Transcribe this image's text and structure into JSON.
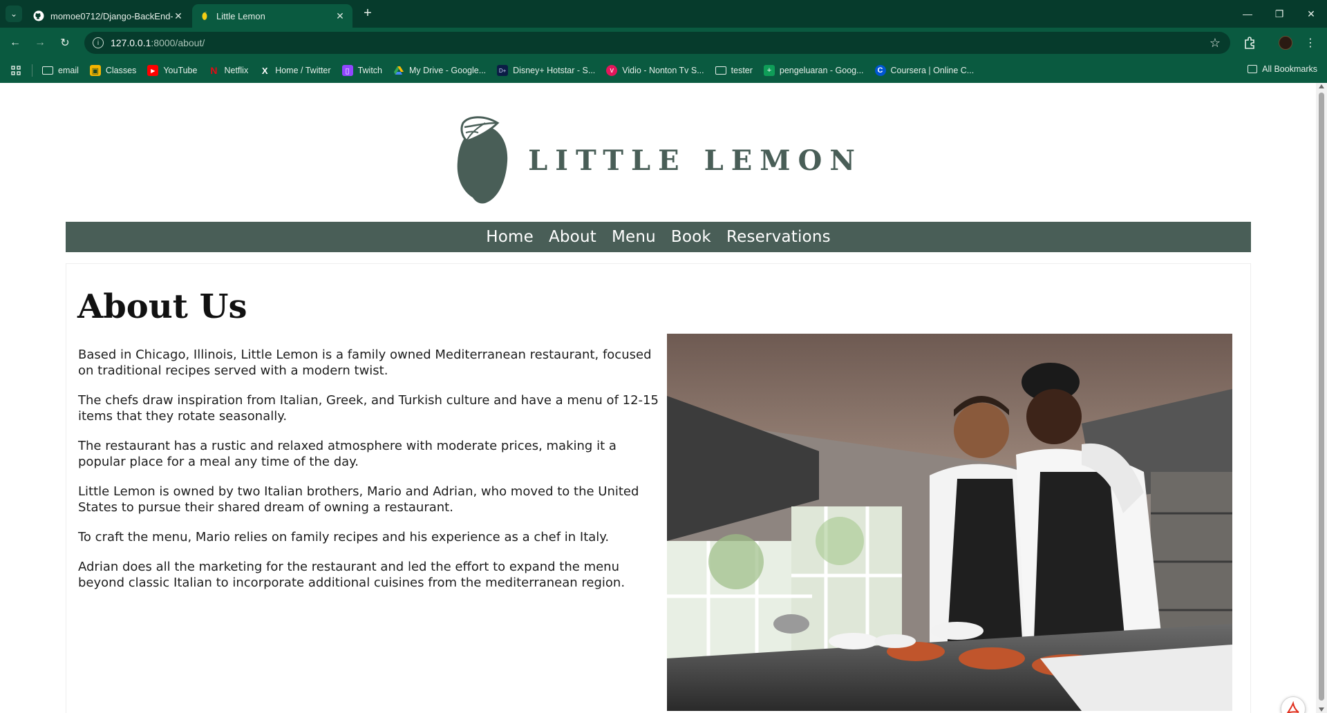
{
  "browser": {
    "tabs": [
      {
        "title": "momoe0712/Django-BackEnd-",
        "active": false,
        "icon": "github-icon"
      },
      {
        "title": "Little Lemon",
        "active": true,
        "icon": "lemon-favicon-icon"
      }
    ],
    "address": {
      "host": "127.0.0.1",
      "path": ":8000/about/"
    },
    "bookmarks": [
      {
        "label": "email",
        "icon": "folder-icon"
      },
      {
        "label": "Classes",
        "icon": "classroom-icon"
      },
      {
        "label": "YouTube",
        "icon": "youtube-icon"
      },
      {
        "label": "Netflix",
        "icon": "netflix-icon"
      },
      {
        "label": "Home / Twitter",
        "icon": "x-icon"
      },
      {
        "label": "Twitch",
        "icon": "twitch-icon"
      },
      {
        "label": "My Drive - Google...",
        "icon": "google-drive-icon"
      },
      {
        "label": "Disney+ Hotstar - S...",
        "icon": "hotstar-icon"
      },
      {
        "label": "Vidio - Nonton Tv S...",
        "icon": "vidio-icon"
      },
      {
        "label": "tester",
        "icon": "folder-icon"
      },
      {
        "label": "pengeluaran - Goog...",
        "icon": "sheets-icon"
      },
      {
        "label": "Coursera | Online C...",
        "icon": "coursera-icon"
      }
    ],
    "all_bookmarks": "All Bookmarks",
    "colors": {
      "frame": "#063b2c",
      "toolbar": "#0a5a40"
    }
  },
  "site": {
    "brand": "LITTLE LEMON",
    "brand_color": "#495e57",
    "nav": [
      "Home",
      "About",
      "Menu",
      "Book",
      "Reservations"
    ],
    "page_title": "About Us",
    "paragraphs": [
      "Based in Chicago, Illinois, Little Lemon is a family owned Mediterranean restaurant, focused on traditional recipes served with a modern twist.",
      "The chefs draw inspiration from Italian, Greek, and Turkish culture and have a menu of 12-15 items that they rotate seasonally.",
      "The restaurant has a rustic and relaxed atmosphere with moderate prices, making it a popular place for a meal any time of the day.",
      "Little Lemon is owned by two Italian brothers, Mario and Adrian, who moved to the United States to pursue their shared dream of owning a restaurant.",
      "To craft the menu, Mario relies on family recipes and his experience as a chef in Italy.",
      "Adrian does all the marketing for the restaurant and led the effort to expand the menu beyond classic Italian to incorporate additional cuisines from the mediterranean region."
    ]
  }
}
